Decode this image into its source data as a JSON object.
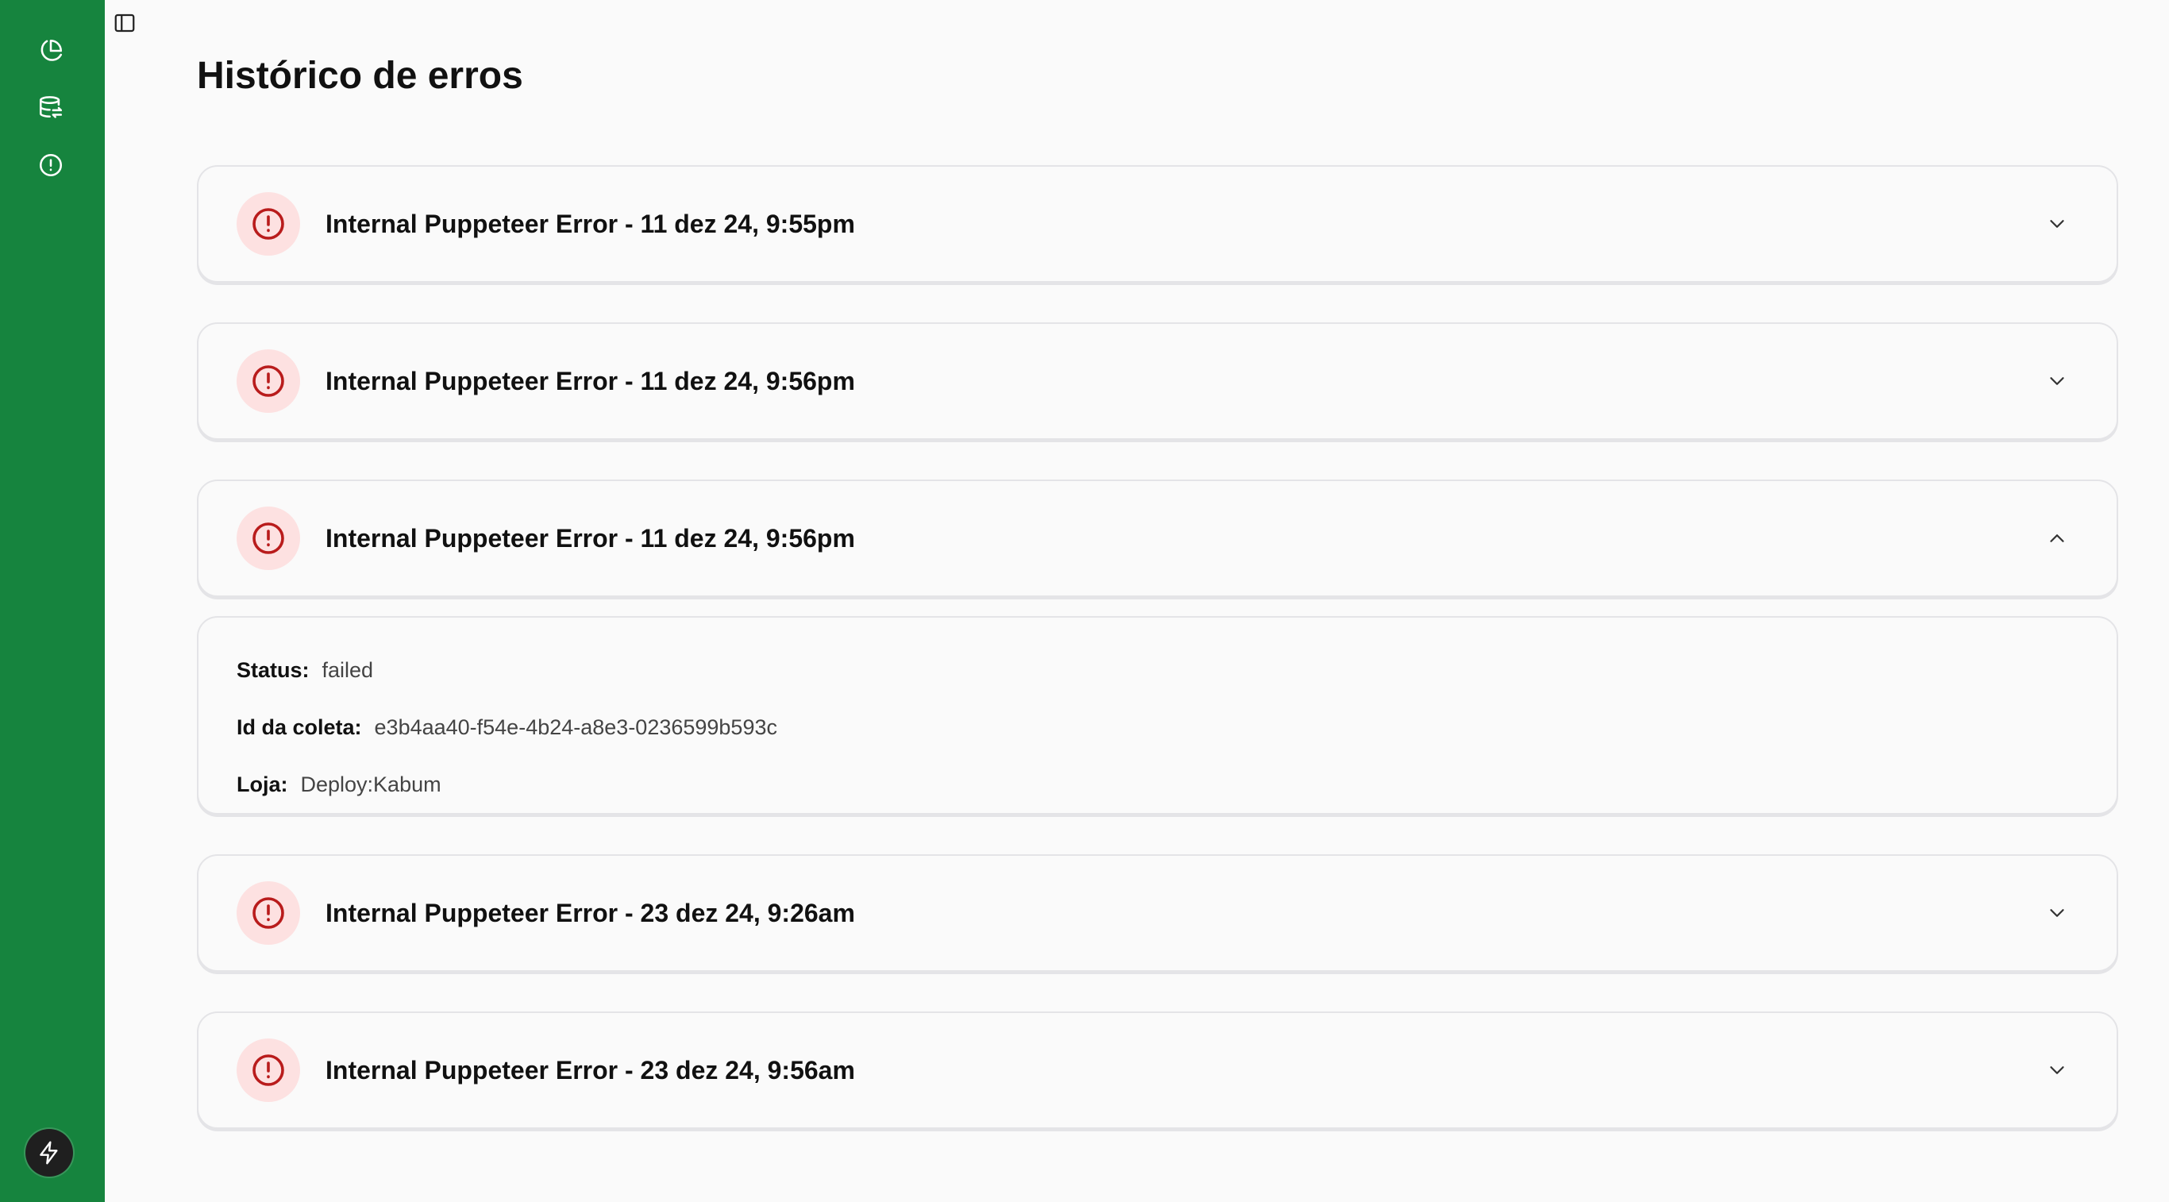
{
  "page": {
    "title": "Histórico de erros"
  },
  "sidebar": {
    "items": [
      {
        "icon": "pie-chart-icon"
      },
      {
        "icon": "database-sync-icon"
      },
      {
        "icon": "alert-circle-icon"
      }
    ],
    "bottom_icon": "zap-icon",
    "toggle_icon": "sidebar-toggle-icon"
  },
  "errors": [
    {
      "title": "Internal Puppeteer Error - 11 dez 24, 9:55pm",
      "expanded": false
    },
    {
      "title": "Internal Puppeteer Error - 11 dez 24, 9:56pm",
      "expanded": false
    },
    {
      "title": "Internal Puppeteer Error - 11 dez 24, 9:56pm",
      "expanded": true,
      "details": {
        "status_label": "Status:",
        "status_value": "failed",
        "id_label": "Id da coleta:",
        "id_value": "e3b4aa40-f54e-4b24-a8e3-0236599b593c",
        "store_label": "Loja:",
        "store_value": "Deploy:Kabum"
      }
    },
    {
      "title": "Internal Puppeteer Error - 23 dez 24, 9:26am",
      "expanded": false
    },
    {
      "title": "Internal Puppeteer Error - 23 dez 24, 9:56am",
      "expanded": false
    }
  ],
  "colors": {
    "sidebar": "#16843e",
    "error_red": "#b91c1c",
    "error_bg": "#fde1e1",
    "border": "#e4e4e7",
    "background": "#fafafa"
  }
}
